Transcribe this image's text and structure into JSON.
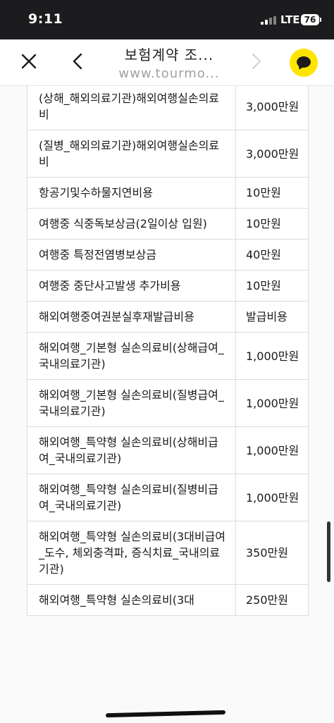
{
  "status_bar": {
    "time": "9:11",
    "network": "LTE",
    "battery": "76"
  },
  "header": {
    "title": "보험계약 조...",
    "url": "www.tourmo..."
  },
  "rows": [
    {
      "name": "(상해_해외의료기관)해외여행실손의료비",
      "amount": "3,000만원"
    },
    {
      "name": "(질병_해외의료기관)해외여행실손의료비",
      "amount": "3,000만원"
    },
    {
      "name": "항공기및수하물지연비용",
      "amount": "10만원"
    },
    {
      "name": "여행중 식중독보상금(2일이상 입원)",
      "amount": "10만원"
    },
    {
      "name": "여행중 특정전염병보상금",
      "amount": "40만원"
    },
    {
      "name": "여행중 중단사고발생 추가비용",
      "amount": "10만원"
    },
    {
      "name": "해외여행중여권분실후재발급비용",
      "amount": "발급비용"
    },
    {
      "name": "해외여행_기본형 실손의료비(상해급여_국내의료기관)",
      "amount": "1,000만원"
    },
    {
      "name": "해외여행_기본형 실손의료비(질병급여_국내의료기관)",
      "amount": "1,000만원"
    },
    {
      "name": "해외여행_특약형 실손의료비(상해비급여_국내의료기관)",
      "amount": "1,000만원"
    },
    {
      "name": "해외여행_특약형 실손의료비(질병비급여_국내의료기관)",
      "amount": "1,000만원"
    },
    {
      "name": "해외여행_특약형 실손의료비(3대비급여_도수, 체외충격파, 증식치료_국내의료기관)",
      "amount": "350만원"
    },
    {
      "name": "해외여행_특약형 실손의료비(3대",
      "amount": "250만원"
    }
  ]
}
